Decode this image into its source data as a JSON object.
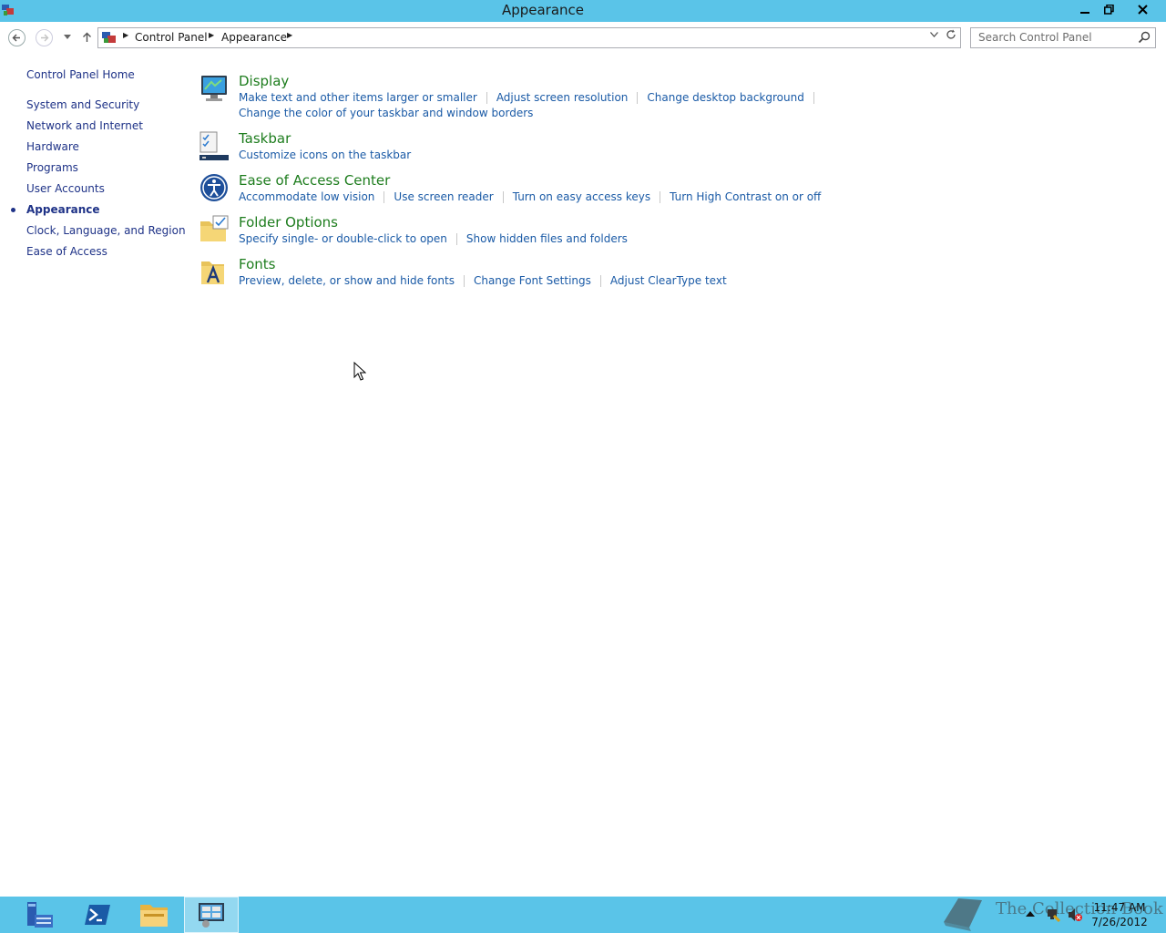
{
  "window": {
    "title": "Appearance",
    "controls": {
      "minimize": "▁",
      "maximize": "❐",
      "close": "✕"
    }
  },
  "address": {
    "crumbs": [
      "Control Panel",
      "Appearance"
    ],
    "search_placeholder": "Search Control Panel"
  },
  "sidebar": {
    "home": "Control Panel Home",
    "items": [
      {
        "label": "System and Security",
        "active": false
      },
      {
        "label": "Network and Internet",
        "active": false
      },
      {
        "label": "Hardware",
        "active": false
      },
      {
        "label": "Programs",
        "active": false
      },
      {
        "label": "User Accounts",
        "active": false
      },
      {
        "label": "Appearance",
        "active": true
      },
      {
        "label": "Clock, Language, and Region",
        "active": false
      },
      {
        "label": "Ease of Access",
        "active": false
      }
    ]
  },
  "categories": [
    {
      "title": "Display",
      "icon": "display-icon",
      "links": [
        [
          "Make text and other items larger or smaller",
          "Adjust screen resolution",
          "Change desktop background"
        ],
        [
          "Change the color of your taskbar and window borders"
        ]
      ]
    },
    {
      "title": "Taskbar",
      "icon": "taskbar-icon",
      "links": [
        [
          "Customize icons on the taskbar"
        ]
      ]
    },
    {
      "title": "Ease of Access Center",
      "icon": "ease-of-access-icon",
      "links": [
        [
          "Accommodate low vision",
          "Use screen reader",
          "Turn on easy access keys",
          "Turn High Contrast on or off"
        ]
      ]
    },
    {
      "title": "Folder Options",
      "icon": "folder-options-icon",
      "links": [
        [
          "Specify single- or double-click to open",
          "Show hidden files and folders"
        ]
      ]
    },
    {
      "title": "Fonts",
      "icon": "fonts-icon",
      "links": [
        [
          "Preview, delete, or show and hide fonts",
          "Change Font Settings",
          "Adjust ClearType text"
        ]
      ]
    }
  ],
  "taskbar": {
    "apps": [
      "server-manager-icon",
      "powershell-icon",
      "file-explorer-icon",
      "control-panel-icon"
    ],
    "active_app": "control-panel-icon",
    "time": "11:47 AM",
    "date": "7/26/2012",
    "watermark": "The Collection Book"
  },
  "colors": {
    "titlebar": "#5ac4e8",
    "link": "#1a5aa6",
    "category_title": "#1e7d1e",
    "nav_text": "#1e3287"
  }
}
